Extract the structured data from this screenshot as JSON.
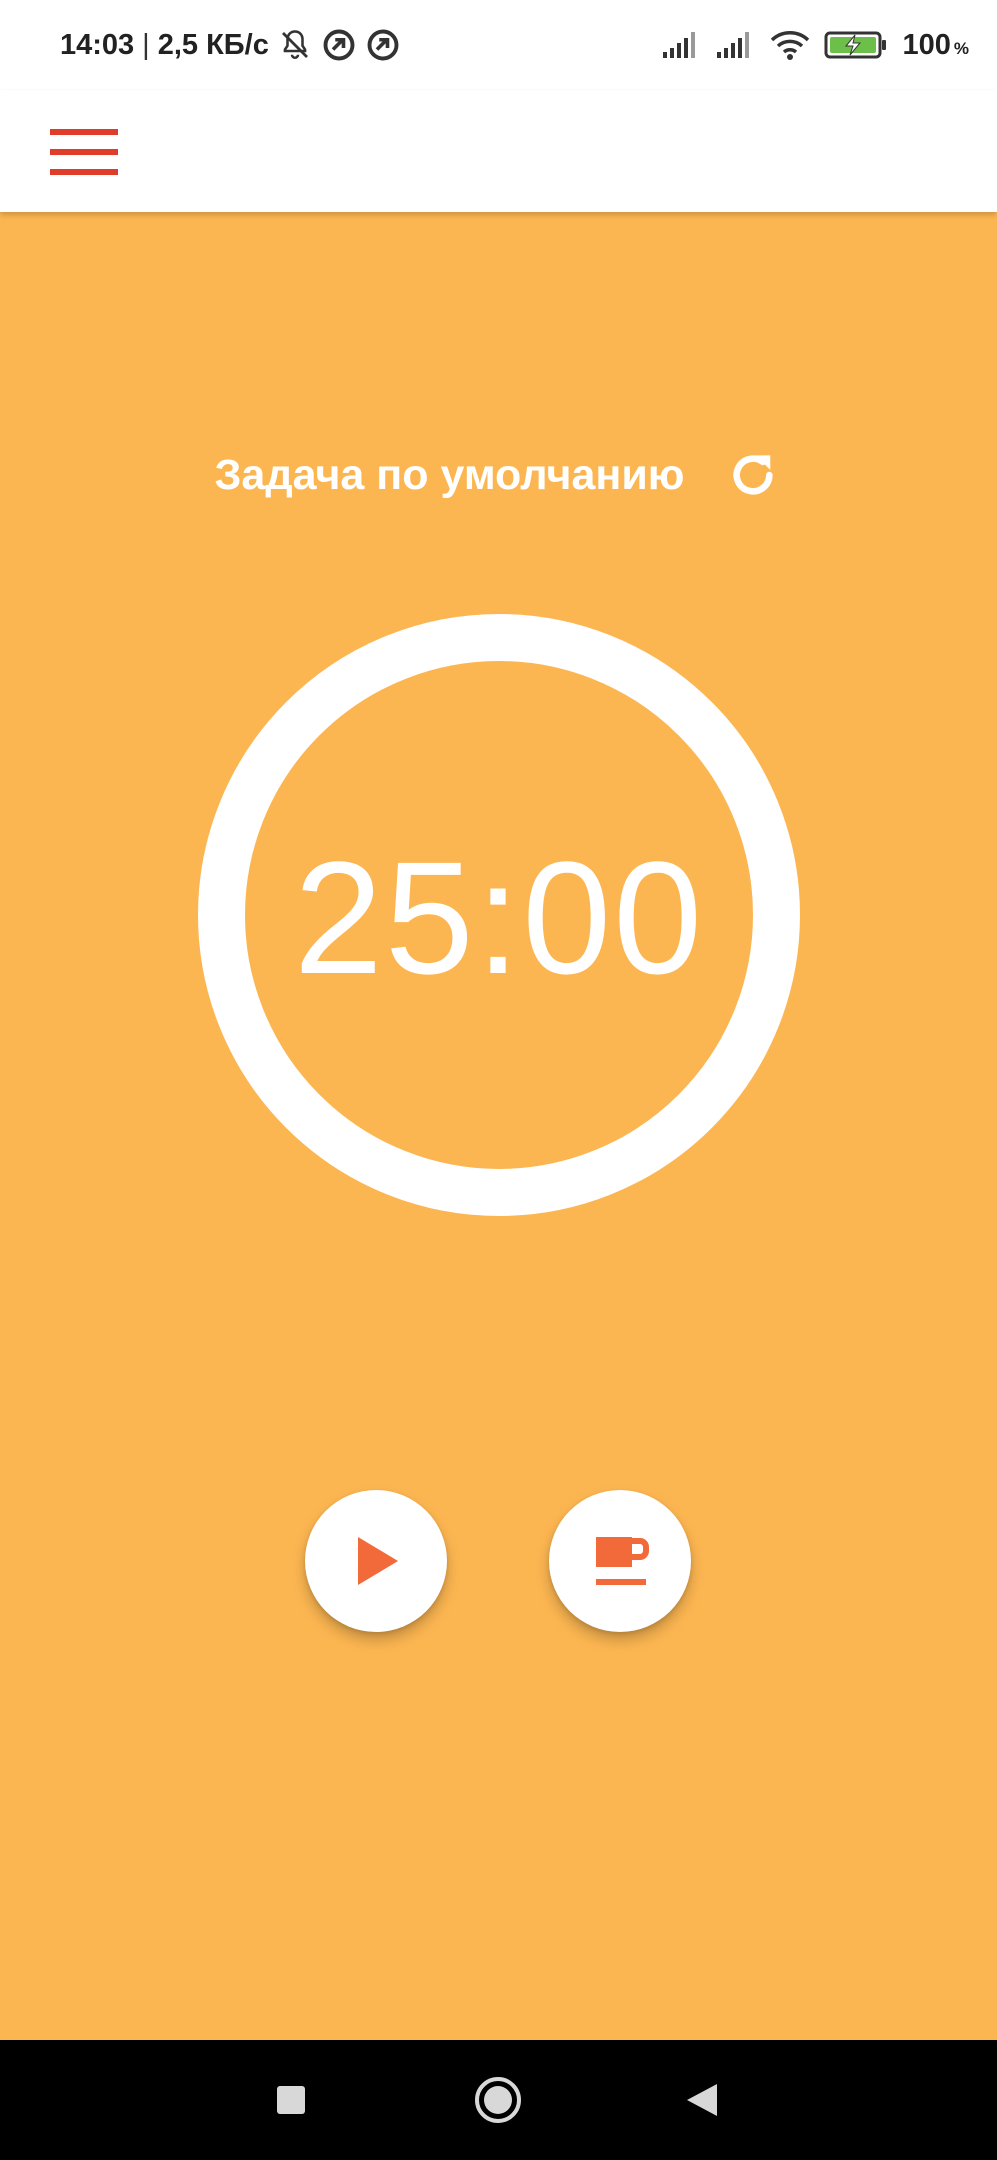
{
  "status_bar": {
    "time": "14:03",
    "separator": "|",
    "speed": "2,5 КБ/с",
    "battery_percent": "100",
    "battery_unit": "%",
    "icons": [
      "mute-bell-icon",
      "app-notification-icon",
      "app-notification-icon",
      "signal-icon",
      "signal-icon",
      "wifi-icon",
      "battery-charging-icon"
    ]
  },
  "app_bar": {
    "menu_icon": "hamburger-menu-icon",
    "accent_color": "#e03c2a"
  },
  "main": {
    "background_color": "#fcb651",
    "task_label": "Задача по умолчанию",
    "refresh_icon": "refresh-icon",
    "timer": "25:00",
    "timer_progress": 1.0
  },
  "actions": {
    "play_icon": "play-icon",
    "break_icon": "coffee-cup-icon",
    "icon_color": "#f26a3a"
  },
  "nav_bar": {
    "icons": [
      "recents-square-icon",
      "home-circle-icon",
      "back-triangle-icon"
    ]
  }
}
